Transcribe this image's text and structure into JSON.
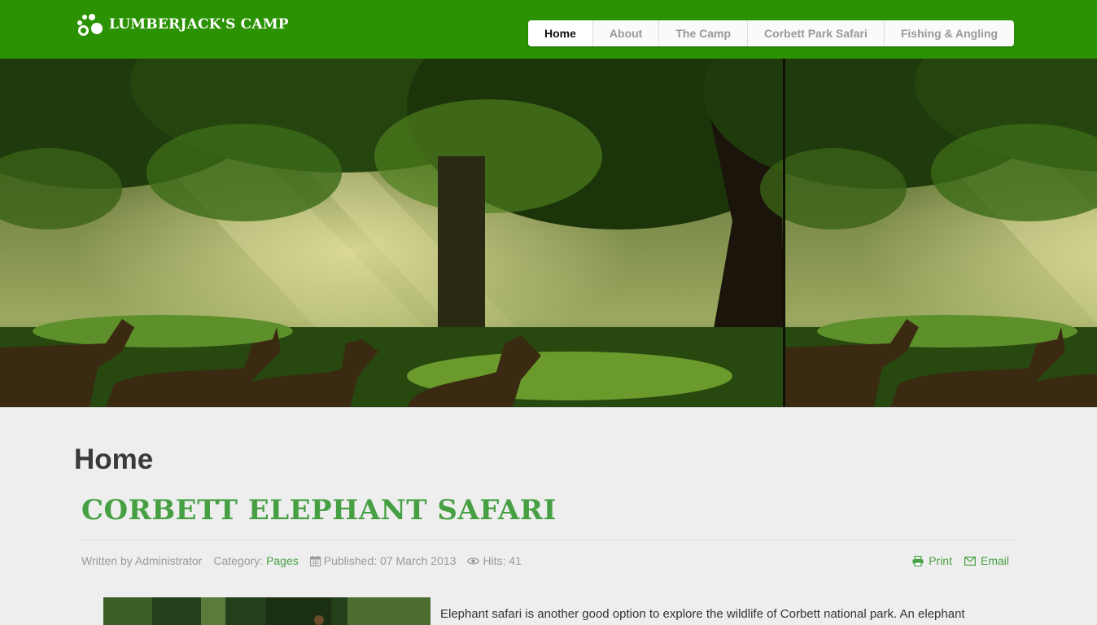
{
  "brand": {
    "name": "LUMBERJACK'S CAMP"
  },
  "nav": {
    "items": [
      {
        "label": "Home",
        "active": true
      },
      {
        "label": "About",
        "active": false
      },
      {
        "label": "The Camp",
        "active": false
      },
      {
        "label": "Corbett Park Safari",
        "active": false
      },
      {
        "label": "Fishing & Angling",
        "active": false
      }
    ]
  },
  "page": {
    "heading": "Home",
    "article_title": "CORBETT ELEPHANT SAFARI",
    "meta": {
      "written_by": "Written by Administrator",
      "category_label": "Category:",
      "category_link": "Pages",
      "published": "Published: 07 March 2013",
      "hits": "Hits: 41"
    },
    "actions": {
      "print": "Print",
      "email": "Email"
    },
    "intro_text": "Elephant safari is another good option to explore the wildlife of Corbett national park. An elephant"
  },
  "colors": {
    "header_green": "#2a9203",
    "link_green": "#46a043",
    "heading_gray": "#3a3a3a"
  }
}
